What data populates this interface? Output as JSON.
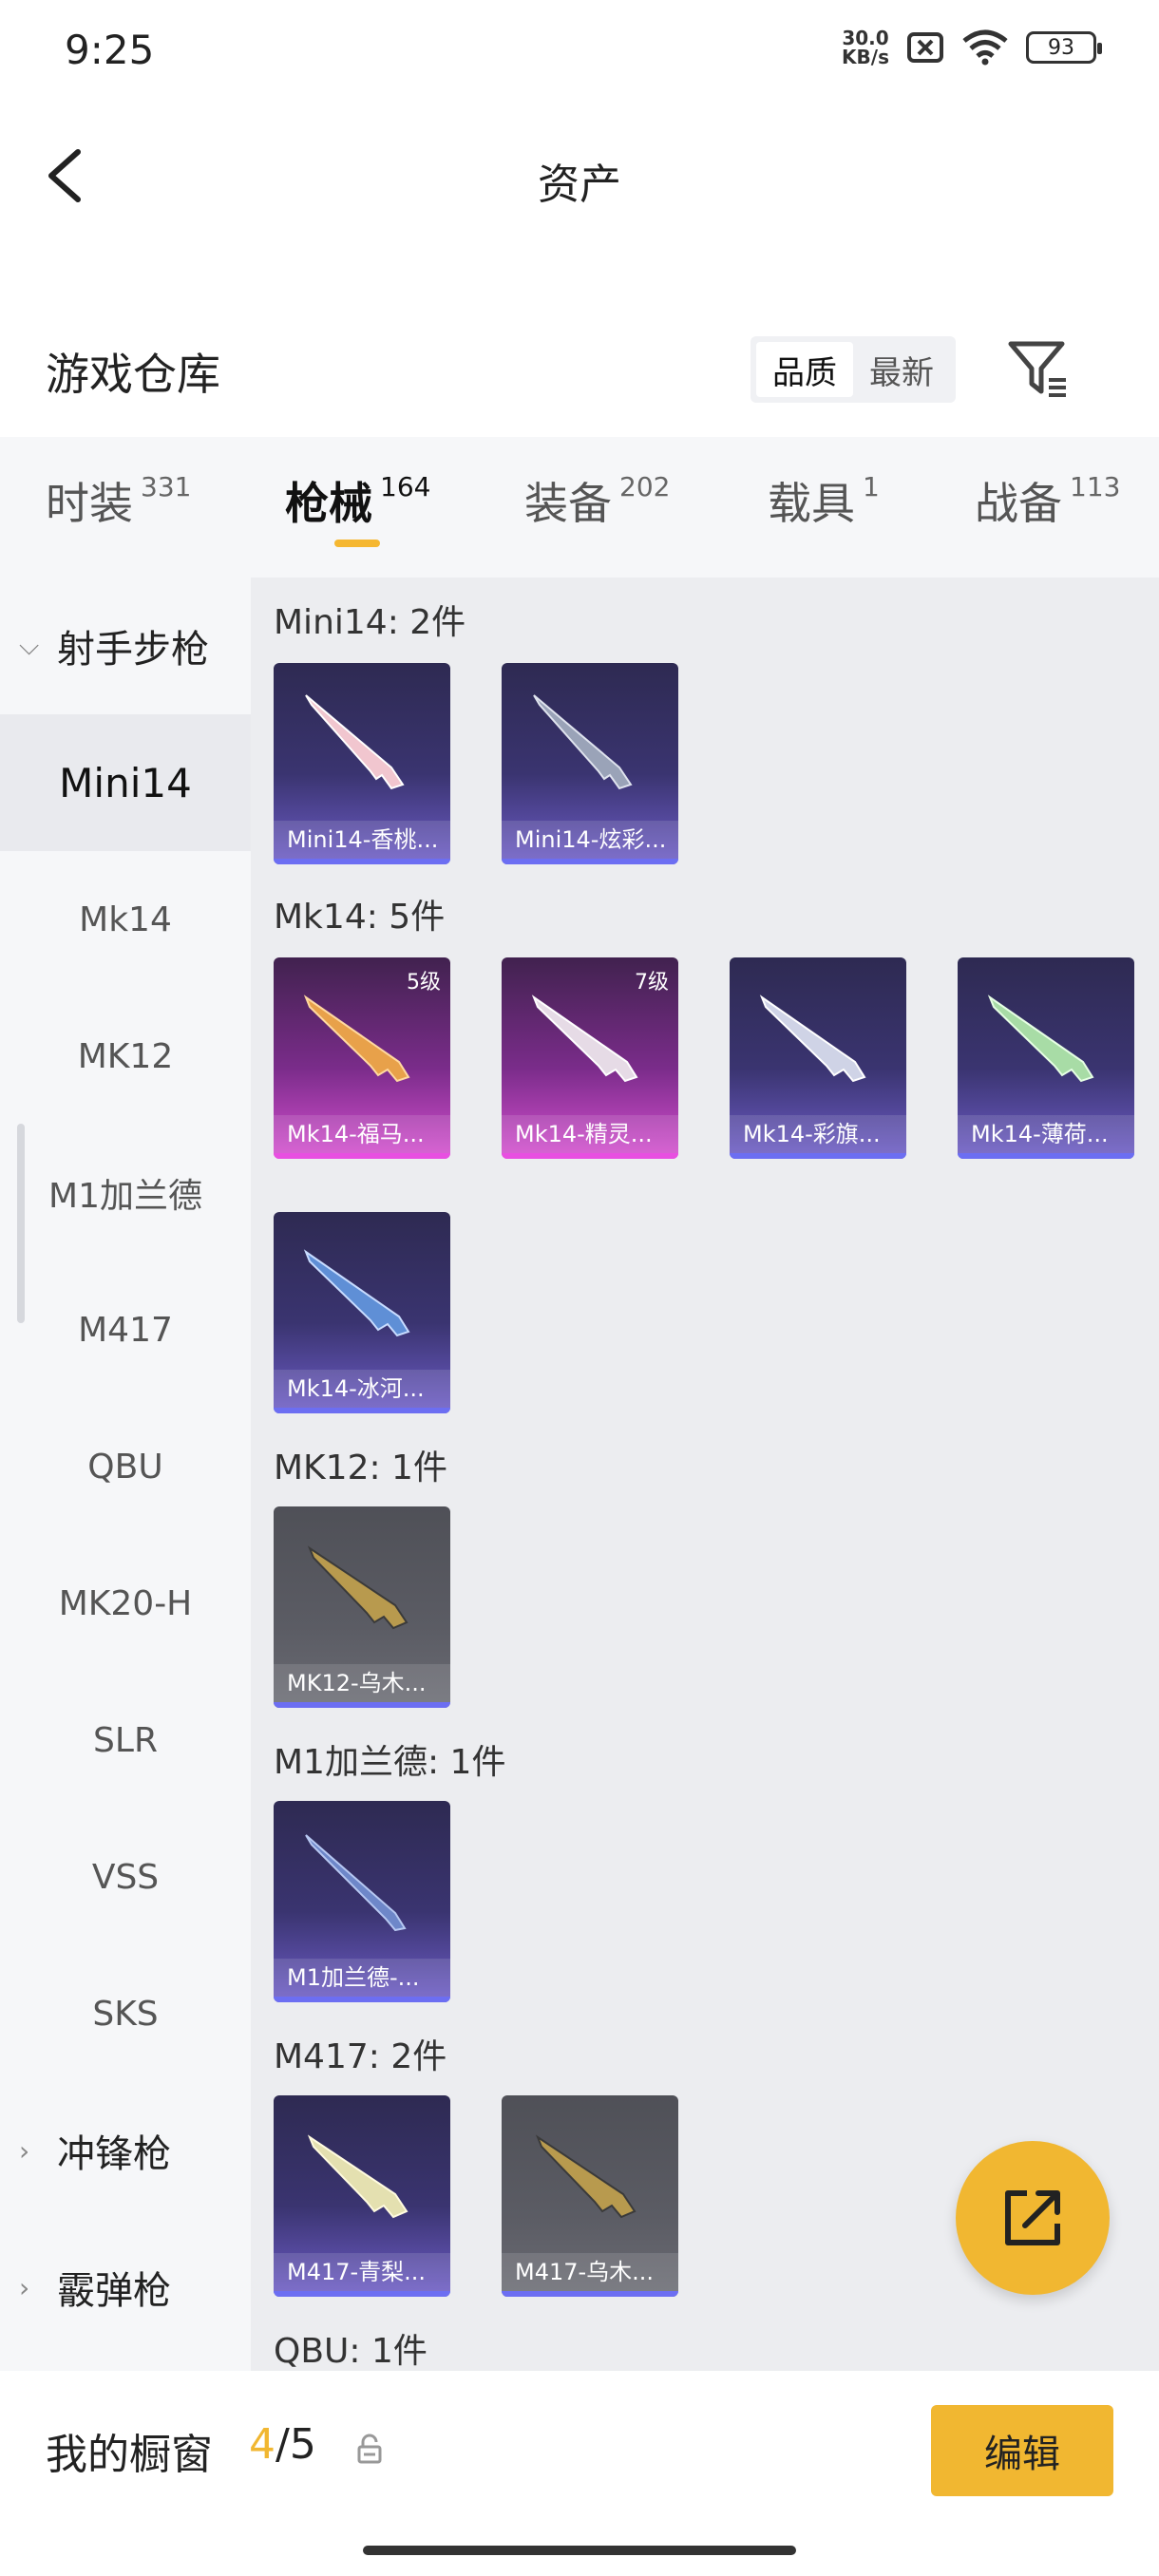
{
  "status": {
    "time": "9:25",
    "net_speed_value": "30.0",
    "net_speed_unit": "KB/s",
    "battery": "93"
  },
  "header": {
    "title": "资产"
  },
  "section": {
    "title": "游戏仓库",
    "sort": [
      "品质",
      "最新"
    ]
  },
  "tabs": [
    {
      "label": "时装",
      "count": "331"
    },
    {
      "label": "枪械",
      "count": "164"
    },
    {
      "label": "装备",
      "count": "202"
    },
    {
      "label": "载具",
      "count": "1"
    },
    {
      "label": "战备",
      "count": "113"
    }
  ],
  "sidebar": {
    "group_open": "射手步枪",
    "items": [
      "Mini14",
      "Mk14",
      "MK12",
      "M1加兰德",
      "M417",
      "QBU",
      "MK20-H",
      "SLR",
      "VSS",
      "SKS"
    ],
    "group_2": "冲锋枪",
    "group_3": "霰弹枪"
  },
  "groups": [
    {
      "title": "Mini14: 2件",
      "cards": [
        {
          "name": "Mini14-香桃...",
          "level": ""
        },
        {
          "name": "Mini14-炫彩...",
          "level": ""
        }
      ]
    },
    {
      "title": "Mk14: 5件",
      "cards": [
        {
          "name": "Mk14-福马...",
          "level": "5级"
        },
        {
          "name": "Mk14-精灵...",
          "level": "7级"
        },
        {
          "name": "Mk14-彩旗...",
          "level": ""
        },
        {
          "name": "Mk14-薄荷...",
          "level": ""
        },
        {
          "name": "Mk14-冰河...",
          "level": ""
        }
      ]
    },
    {
      "title": "MK12: 1件",
      "cards": [
        {
          "name": "MK12-乌木...",
          "level": ""
        }
      ]
    },
    {
      "title": "M1加兰德: 1件",
      "cards": [
        {
          "name": "M1加兰德-...",
          "level": ""
        }
      ]
    },
    {
      "title": "M417: 2件",
      "cards": [
        {
          "name": "M417-青梨...",
          "level": ""
        },
        {
          "name": "M417-乌木...",
          "level": ""
        }
      ]
    },
    {
      "title": "QBU: 1件",
      "cards": []
    }
  ],
  "bottom": {
    "label": "我的橱窗",
    "current": "4",
    "separator": "/",
    "total": "5",
    "edit": "编辑"
  },
  "icons": {
    "back": "back-arrow-icon",
    "filter": "filter-icon",
    "share": "share-icon",
    "lock": "lock-icon"
  },
  "colors": {
    "accent": "#f1b731",
    "rare_purple": "#6c6ef2",
    "legendary_pink": "#e84fe1"
  }
}
